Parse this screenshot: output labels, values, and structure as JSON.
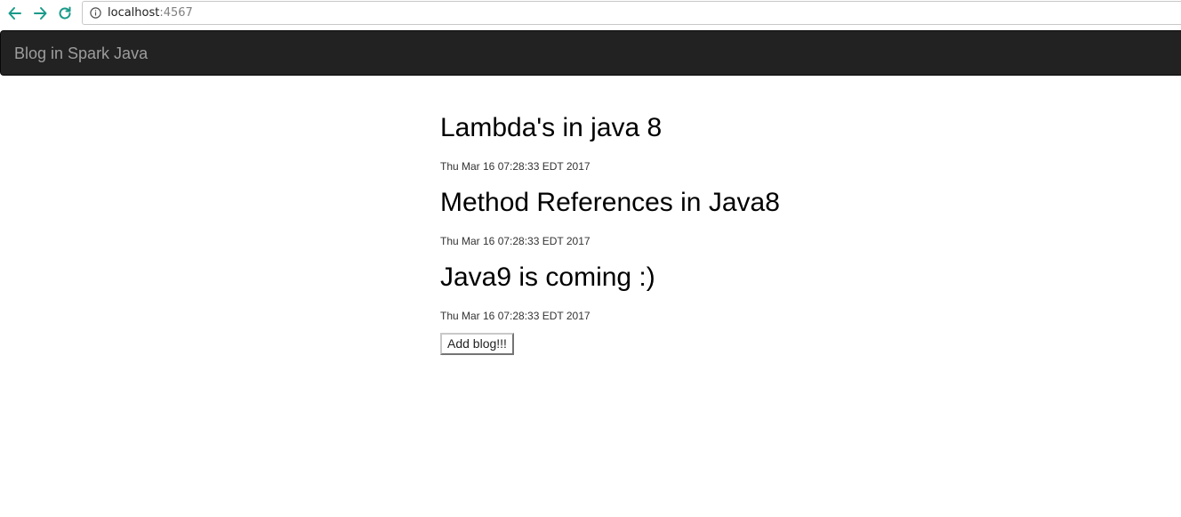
{
  "browser": {
    "url_host": "localhost",
    "url_port": ":4567",
    "back_icon": "arrow-left-icon",
    "forward_icon": "arrow-right-icon",
    "reload_icon": "reload-icon",
    "info_icon": "info-icon",
    "accent_color": "#1a9a8a"
  },
  "navbar": {
    "brand": "Blog in Spark Java",
    "background": "#222222",
    "brand_color": "#9d9d9d"
  },
  "posts": [
    {
      "title": "Lambda's in java 8",
      "date": "Thu Mar 16 07:28:33 EDT 2017"
    },
    {
      "title": "Method References in Java8",
      "date": "Thu Mar 16 07:28:33 EDT 2017"
    },
    {
      "title": "Java9 is coming :)",
      "date": "Thu Mar 16 07:28:33 EDT 2017"
    }
  ],
  "actions": {
    "add_blog_label": "Add blog!!!"
  }
}
